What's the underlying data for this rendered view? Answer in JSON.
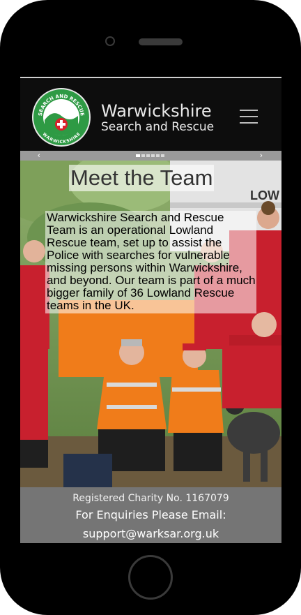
{
  "header": {
    "logo_ring_text_top": "SEARCH AND RESCUE",
    "logo_ring_text_bottom": "WARWICKSHIRE",
    "site_name_line1": "Warwickshire",
    "site_name_line2": "Search and Rescue",
    "menu_icon": "hamburger-menu-icon"
  },
  "slider": {
    "prev_arrow": "‹",
    "next_arrow": "›",
    "slide_count": 6,
    "active_slide": 1
  },
  "team": {
    "title": "Meet the Team",
    "description": "Warwickshire Search and Rescue Team is an operational Lowland Rescue team, set up to assist the Police with searches for vulnerable missing persons within Warwickshire, and beyond. Our team is part of a much bigger family of 36 Lowland Rescue teams in the UK.",
    "vehicle_text": "LOW"
  },
  "footer": {
    "charity": "Registered Charity No. 1167079",
    "enquiries": "For Enquiries Please Email:",
    "email": "support@warksar.org.uk"
  },
  "colors": {
    "logo_green": "#2e9a44",
    "logo_red": "#d8222a",
    "hi_vis_orange": "#f07c1a",
    "jacket_red": "#c8202e",
    "footer_gray": "#757575"
  }
}
